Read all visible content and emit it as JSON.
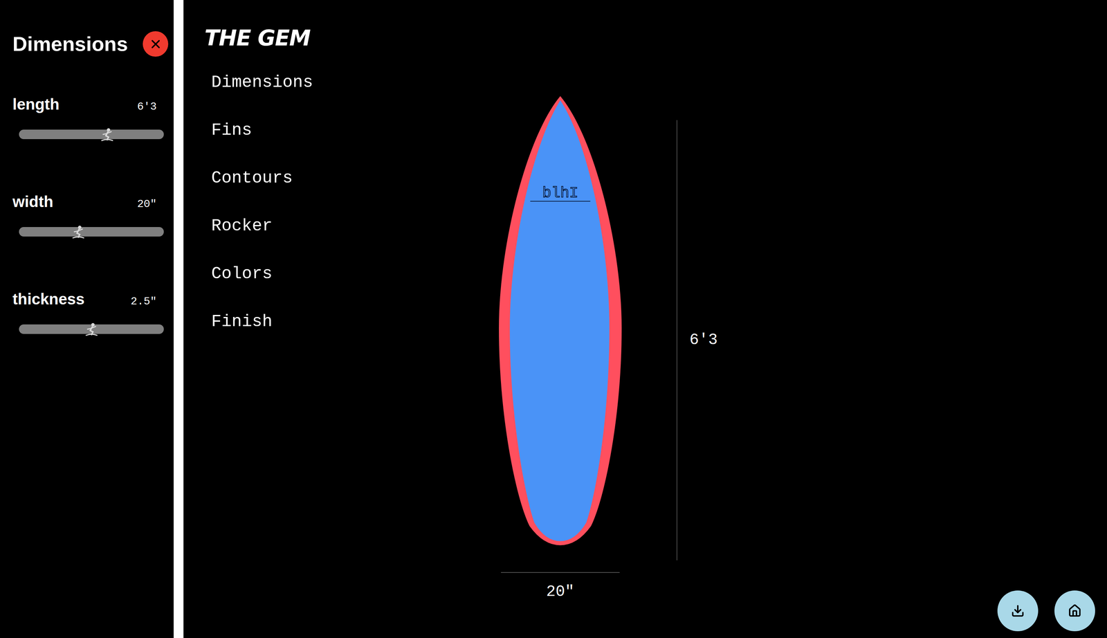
{
  "sidebar": {
    "title": "Dimensions",
    "sliders": [
      {
        "label": "length",
        "value": "6'3",
        "level": 0.61
      },
      {
        "label": "width",
        "value": "20\"",
        "level": 0.41
      },
      {
        "label": "thickness",
        "value": "2.5\"",
        "level": 0.5
      }
    ]
  },
  "main": {
    "title": "THE GEM",
    "menu": [
      {
        "label": "Dimensions"
      },
      {
        "label": "Fins"
      },
      {
        "label": "Contours"
      },
      {
        "label": "Rocker"
      },
      {
        "label": "Colors"
      },
      {
        "label": "Finish"
      }
    ]
  },
  "board": {
    "logo": "blhI",
    "length": "6'3",
    "width": "20\""
  }
}
